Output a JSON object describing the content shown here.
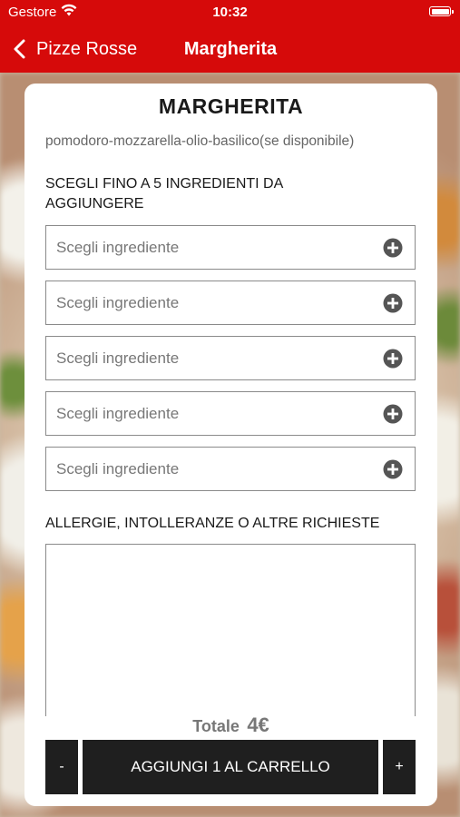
{
  "status_bar": {
    "carrier": "Gestore",
    "time": "10:32"
  },
  "nav": {
    "back_label": "Pizze Rosse",
    "title": "Margherita"
  },
  "product": {
    "name": "MARGHERITA",
    "description": "pomodoro-mozzarella-olio-basilico(se disponibile)"
  },
  "ingredients": {
    "section_title": "SCEGLI FINO A 5 INGREDIENTI DA AGGIUNGERE",
    "pickers": [
      {
        "placeholder": "Scegli ingrediente",
        "icon": "plus-circle-icon"
      },
      {
        "placeholder": "Scegli ingrediente",
        "icon": "plus-circle-icon"
      },
      {
        "placeholder": "Scegli ingrediente",
        "icon": "plus-circle-icon"
      },
      {
        "placeholder": "Scegli ingrediente",
        "icon": "plus-circle-icon"
      },
      {
        "placeholder": "Scegli ingrediente",
        "icon": "plus-circle-icon"
      }
    ]
  },
  "notes": {
    "section_title": "ALLERGIE, INTOLLERANZE O ALTRE RICHIESTE",
    "value": ""
  },
  "footer": {
    "total_label": "Totale",
    "total_amount": "4€",
    "minus_label": "-",
    "add_label": "AGGIUNGI 1 AL CARRELLO",
    "plus_label": "+"
  },
  "colors": {
    "brand_red": "#d60a0a",
    "button_dark": "#1f1f1f"
  }
}
